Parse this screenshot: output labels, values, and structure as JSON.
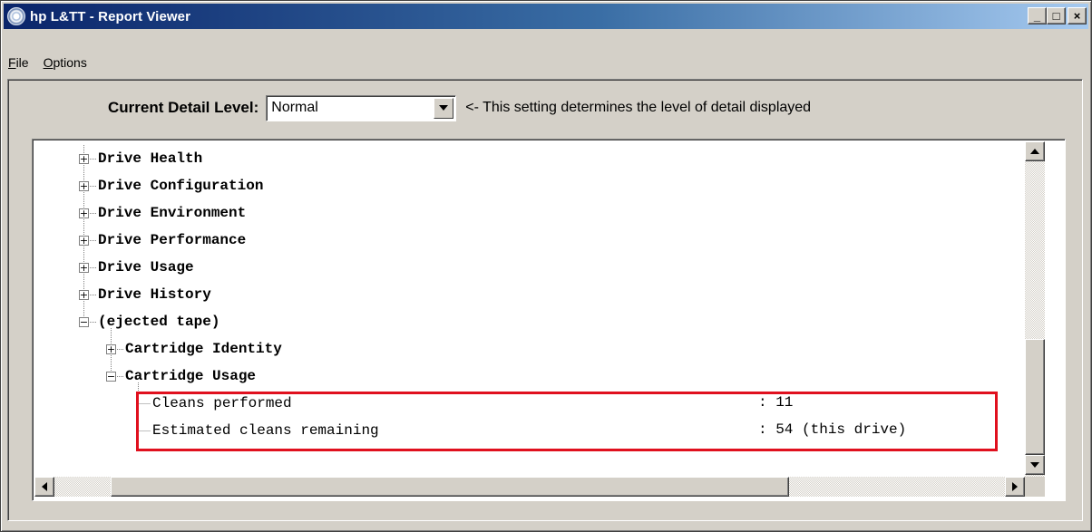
{
  "window": {
    "title": "hp L&TT - Report Viewer",
    "minimize_label": "_",
    "maximize_label": "□",
    "close_label": "×",
    "app_icon": "hp-swirl-icon"
  },
  "menu": {
    "items": [
      "File",
      "Options"
    ]
  },
  "detail": {
    "label": "Current Detail Level:",
    "selected": "Normal",
    "hint": "<- This setting determines the level of detail displayed"
  },
  "tree": {
    "items": [
      {
        "label": "Drive Health",
        "expander": "+"
      },
      {
        "label": "Drive Configuration",
        "expander": "+"
      },
      {
        "label": "Drive Environment",
        "expander": "+"
      },
      {
        "label": "Drive Performance",
        "expander": "+"
      },
      {
        "label": "Drive Usage",
        "expander": "+"
      },
      {
        "label": "Drive History",
        "expander": "+"
      },
      {
        "label": "(ejected tape)",
        "expander": "−"
      },
      {
        "label": "Cartridge Identity",
        "expander": "+"
      },
      {
        "label": "Cartridge Usage",
        "expander": "−"
      },
      {
        "label": "Cleans performed",
        "value": ": 11"
      },
      {
        "label": "Estimated cleans remaining",
        "value": ": 54 (this drive)"
      }
    ]
  },
  "colors": {
    "highlight": "#e0101e",
    "titlebar_start": "#0a246a",
    "titlebar_end": "#a6caf0",
    "face": "#d4d0c8"
  }
}
